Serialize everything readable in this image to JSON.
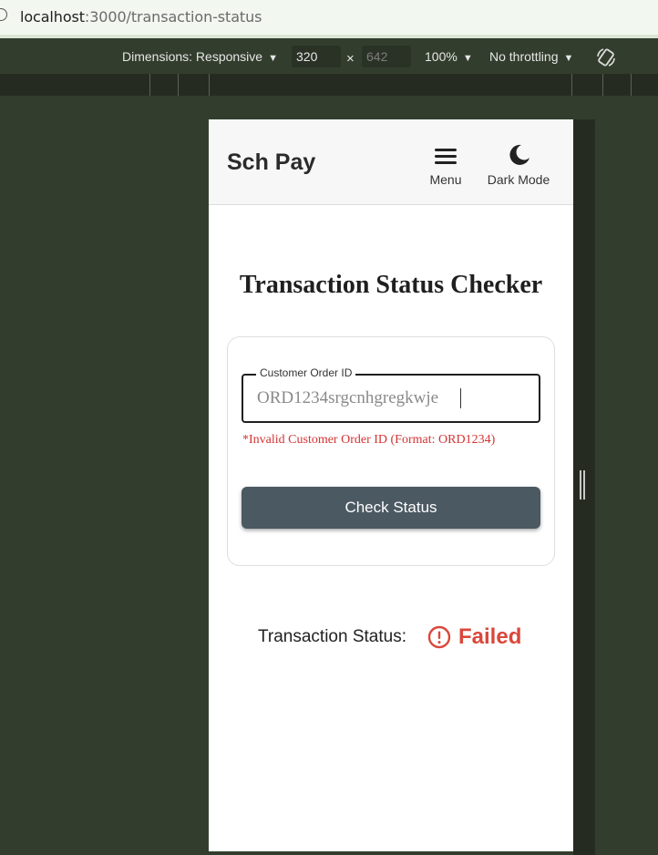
{
  "browser": {
    "url_host": "localhost",
    "url_path": ":3000/transaction-status"
  },
  "devtools": {
    "dimensions_label": "Dimensions: Responsive",
    "width": "320",
    "times": "×",
    "height": "642",
    "zoom": "100%",
    "throttling": "No throttling"
  },
  "app": {
    "brand": "Sch Pay",
    "menu_label": "Menu",
    "dark_mode_label": "Dark Mode",
    "title": "Transaction Status Checker",
    "form": {
      "field_label": "Customer Order ID",
      "field_value": "ORD1234srgcnhgregkwje",
      "error": "*Invalid Customer Order ID (Format: ORD1234)",
      "button_label": "Check Status"
    },
    "status": {
      "label": "Transaction Status:",
      "value": "Failed",
      "color": "#d9483b"
    }
  }
}
